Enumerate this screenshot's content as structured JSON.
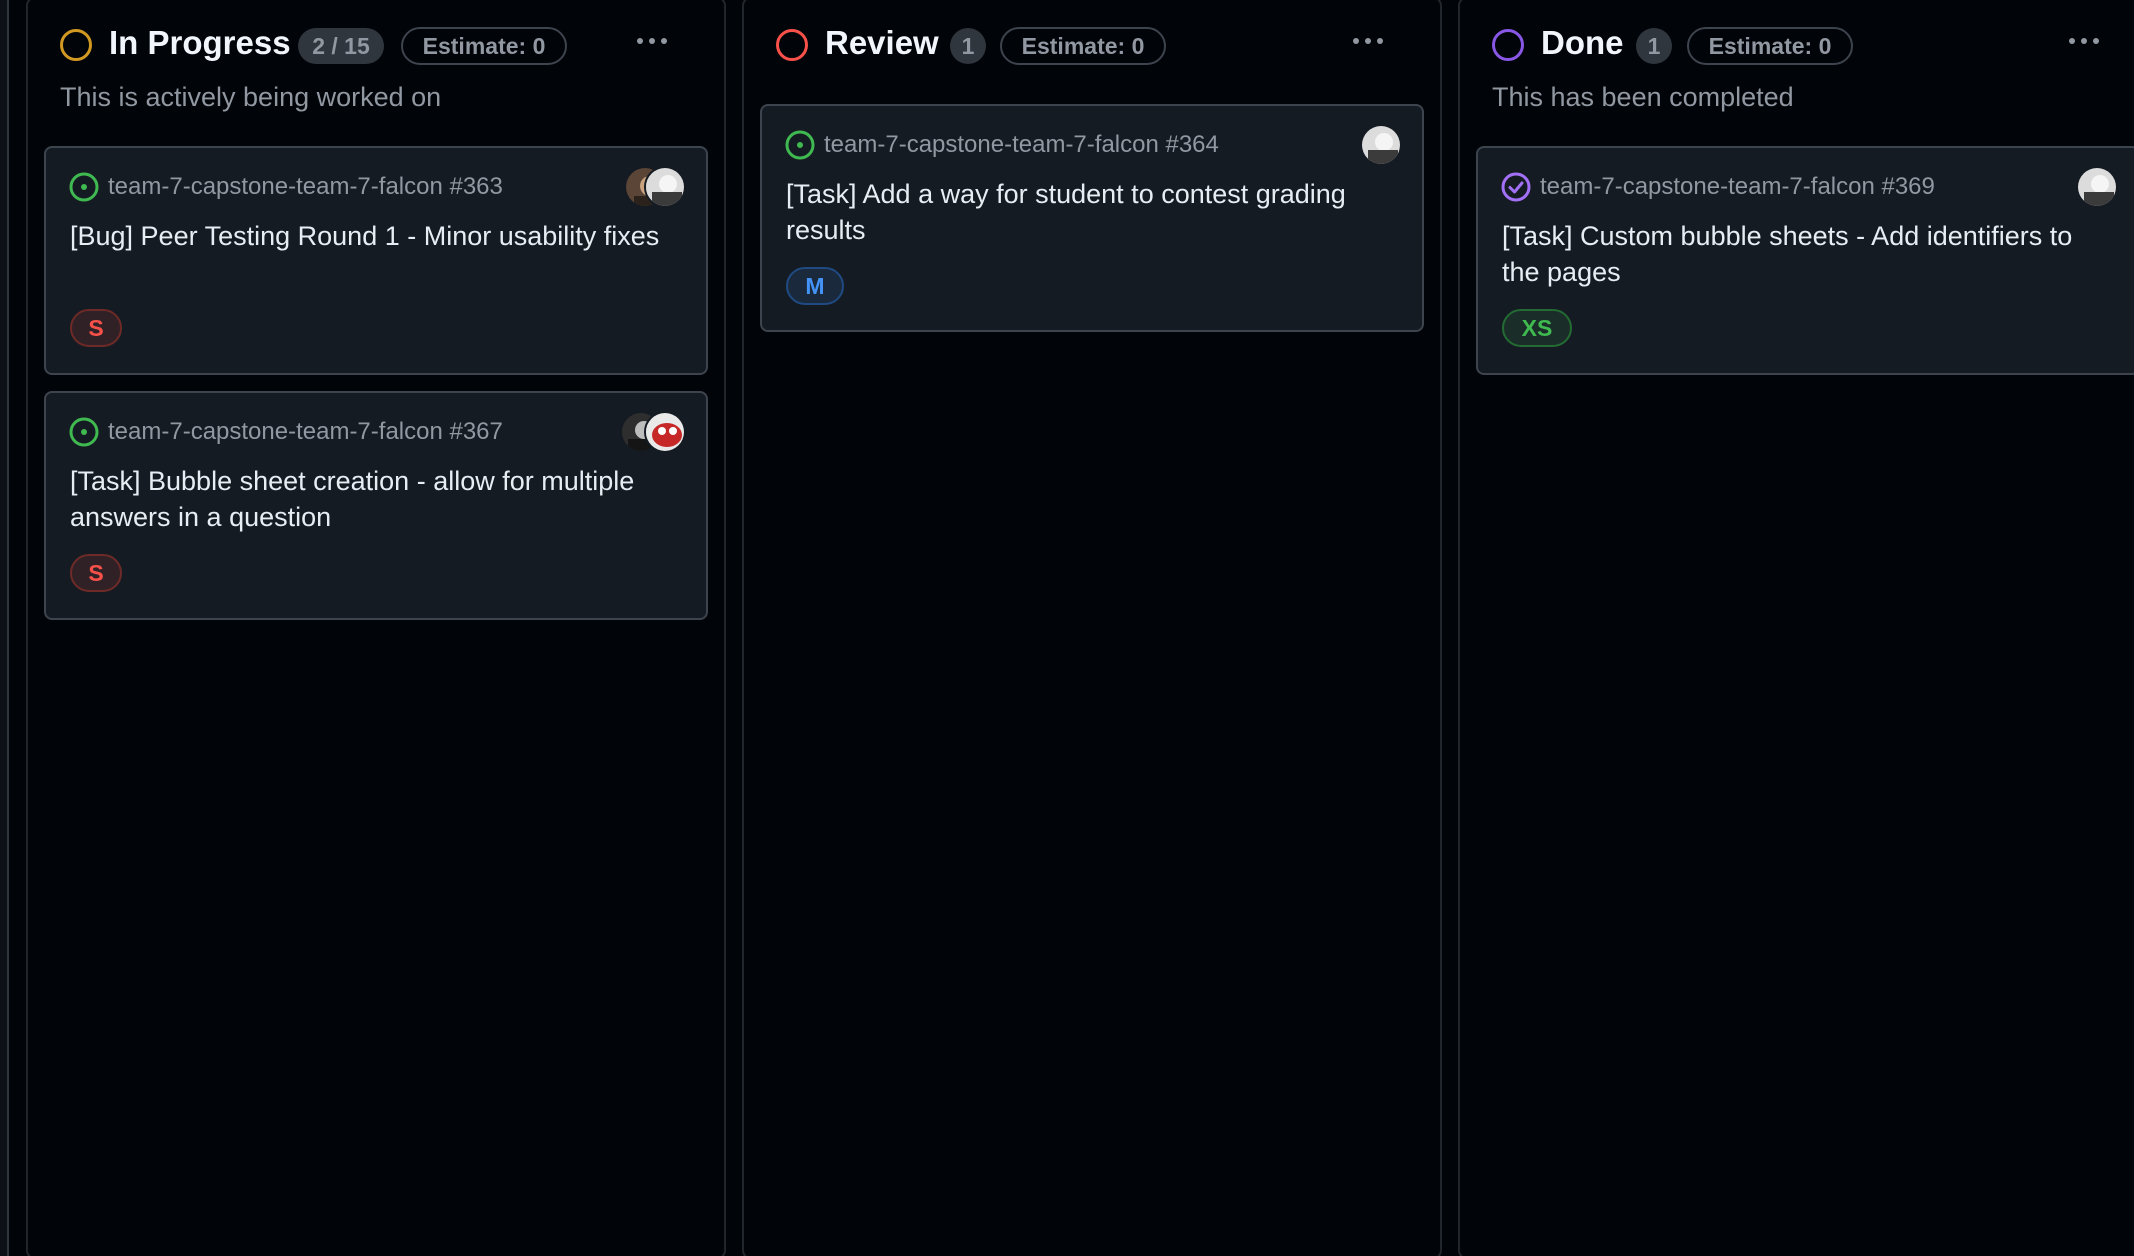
{
  "columns": [
    {
      "title": "In Progress",
      "count": "2 / 15",
      "estimate": "Estimate: 0",
      "description": "This is actively being worked on",
      "status_color": "#d29922",
      "cards": [
        {
          "repo": "team-7-capstone-team-7-falcon #363",
          "title": "[Bug] Peer Testing Round 1 - Minor usability fixes",
          "size": "S",
          "state": "open",
          "state_icon": "issue-opened-icon"
        },
        {
          "repo": "team-7-capstone-team-7-falcon #367",
          "title": "[Task] Bubble sheet creation - allow for multiple answers in a question",
          "size": "S",
          "state": "open",
          "state_icon": "issue-opened-icon"
        }
      ]
    },
    {
      "title": "Review",
      "count": "1",
      "estimate": "Estimate: 0",
      "description": "",
      "status_color": "#f85149",
      "cards": [
        {
          "repo": "team-7-capstone-team-7-falcon #364",
          "title": "[Task] Add a way for student to contest grading results",
          "size": "M",
          "state": "open",
          "state_icon": "issue-opened-icon"
        }
      ]
    },
    {
      "title": "Done",
      "count": "1",
      "estimate": "Estimate: 0",
      "description": "This has been completed",
      "status_color": "#8957e5",
      "cards": [
        {
          "repo": "team-7-capstone-team-7-falcon #369",
          "title": "[Task] Custom bubble sheets - Add identifiers to the pages",
          "size": "XS",
          "state": "closed",
          "state_icon": "issue-closed-icon"
        }
      ]
    }
  ],
  "colors": {
    "background": "#010409",
    "card_background": "#151b23",
    "border": "#3d444d",
    "muted_text": "#9198a1",
    "open_green": "#3fb950",
    "closed_purple": "#a371f7",
    "size_s": "#f85149",
    "size_m": "#4493f8",
    "size_xs": "#3fb950"
  }
}
